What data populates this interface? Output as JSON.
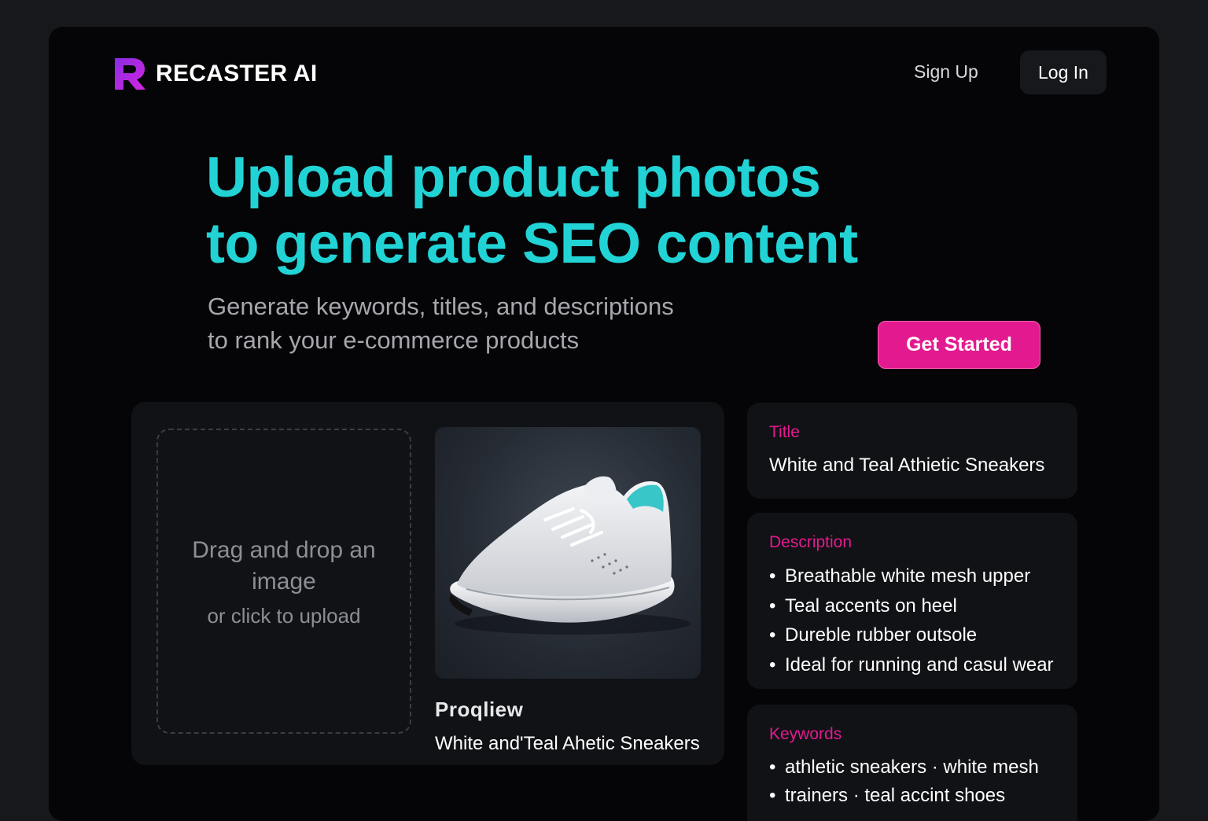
{
  "brand": {
    "name": "RECASTER AI",
    "logo_icon": "r-logo-icon",
    "logo_gradient": [
      "#8a2ce2",
      "#d326e0"
    ]
  },
  "nav": {
    "signup_label": "Sign Up",
    "login_label": "Log In"
  },
  "hero": {
    "headline_line1": "Upload product photos",
    "headline_line2": "to generate SEO content",
    "subhead_line1": "Generate keywords, titles, and descriptions",
    "subhead_line2": "to rank your e-commerce products",
    "cta_label": "Get Started"
  },
  "upload": {
    "dropzone_main": "Drag and drop an image",
    "dropzone_sub": "or click to upload",
    "preview_icon": "sneaker-image",
    "preview_label": "Proqliew",
    "preview_name": "White and'Teal Ahetic Sneakers"
  },
  "results": {
    "title": {
      "label": "Title",
      "value": "White and Teal Athietic Sneakers"
    },
    "description": {
      "label": "Description",
      "items": [
        "Breathable white mesh upper",
        "Teal accents on heel",
        "Dureble rubber outsole",
        "Ideal for running and casul wear"
      ]
    },
    "keywords": {
      "label": "Keywords",
      "items": [
        "athletic sneakers · white mesh",
        "trainers · teal accint shoes"
      ]
    }
  },
  "colors": {
    "accent_teal": "#22d3d6",
    "accent_pink": "#e31a8f",
    "background": "#050507",
    "card": "#111216"
  }
}
